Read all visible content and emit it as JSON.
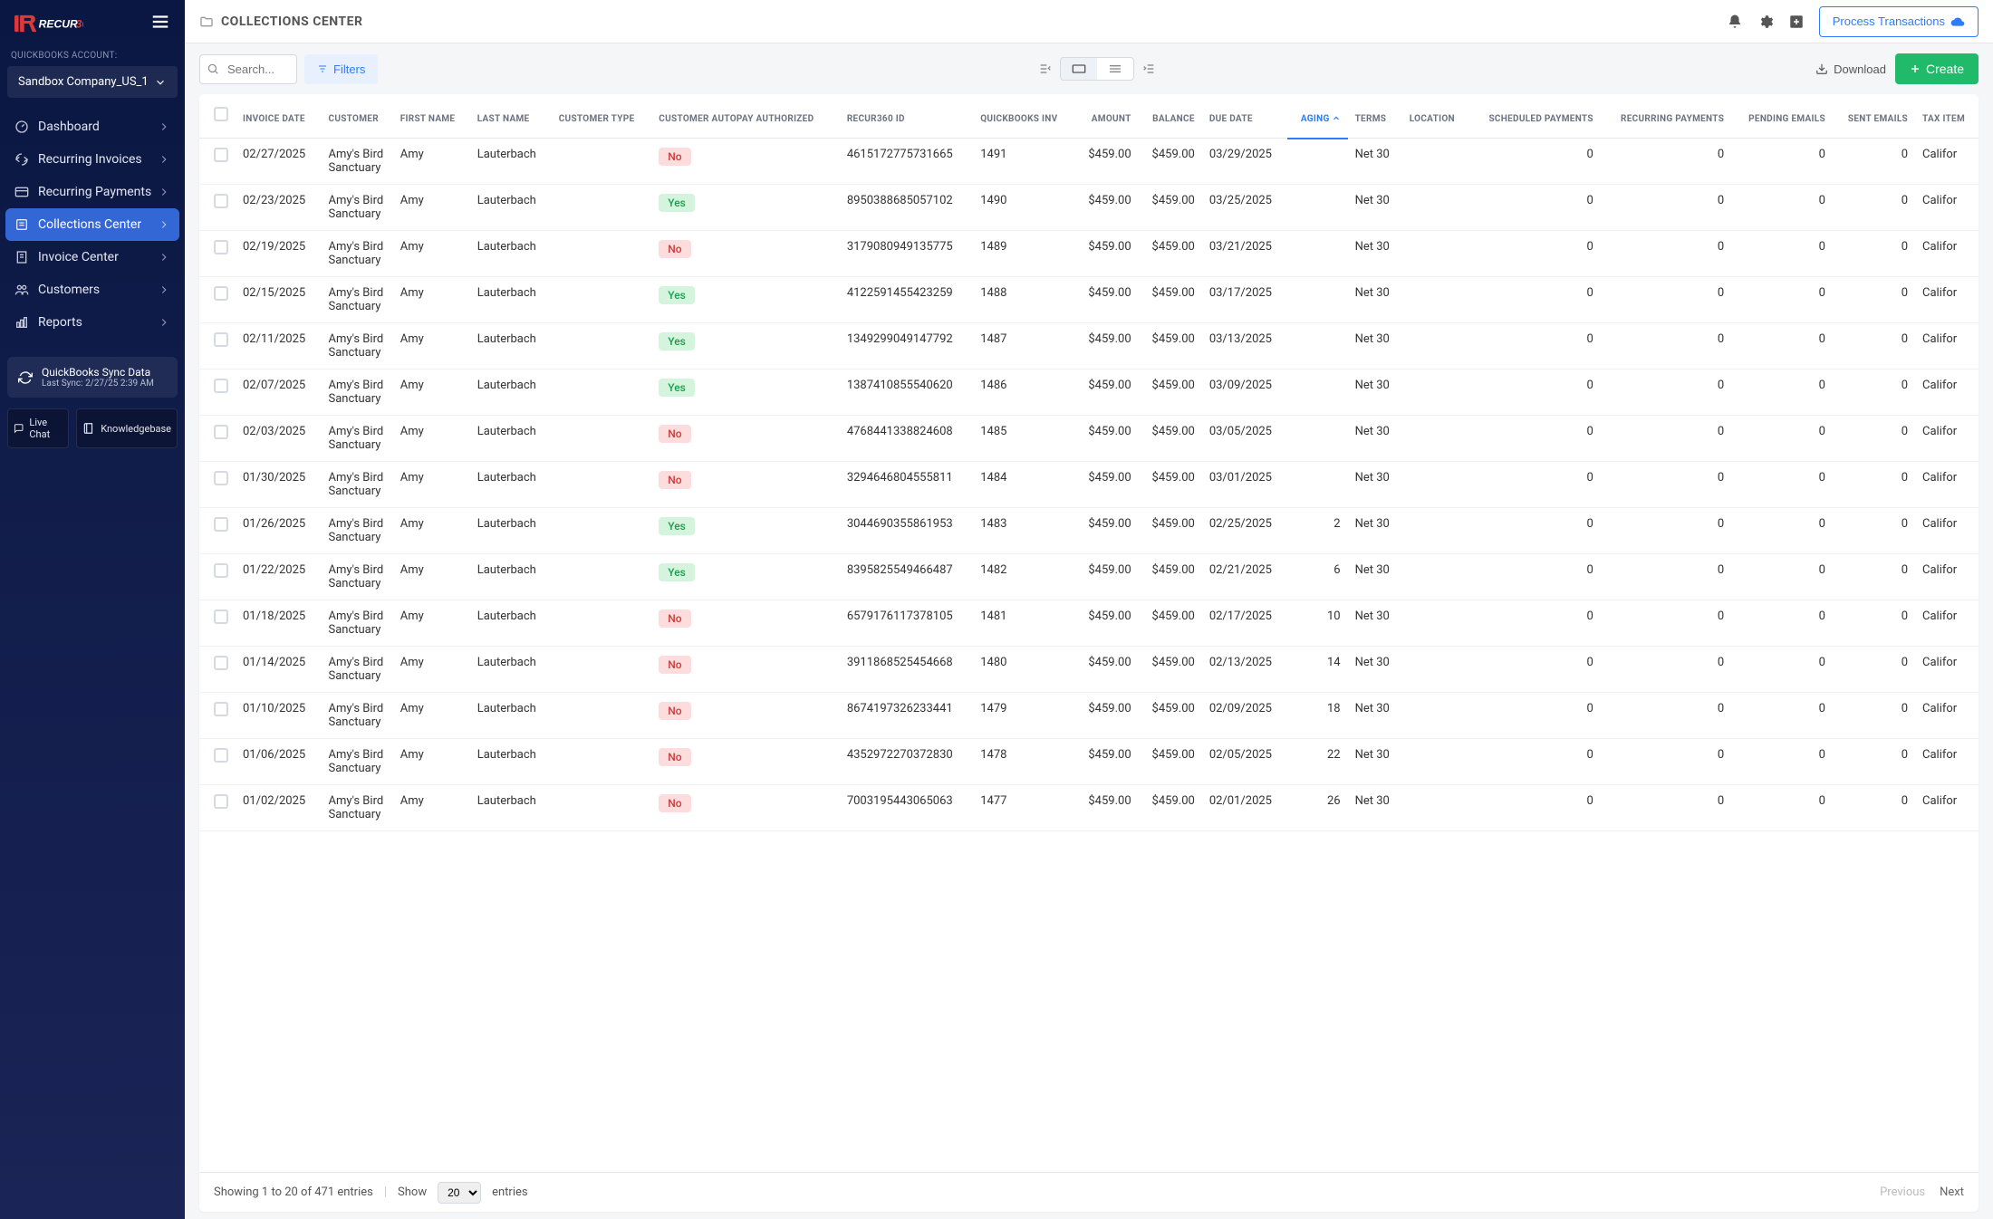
{
  "brand": {
    "name": "RECUR",
    "suffix": "360"
  },
  "qb_label": "QUICKBOOKS ACCOUNT:",
  "account": "Sandbox Company_US_1",
  "nav": [
    {
      "label": "Dashboard",
      "icon": "dashboard"
    },
    {
      "label": "Recurring Invoices",
      "icon": "recur"
    },
    {
      "label": "Recurring Payments",
      "icon": "card"
    },
    {
      "label": "Collections Center",
      "icon": "collections",
      "active": true
    },
    {
      "label": "Invoice Center",
      "icon": "invoice"
    },
    {
      "label": "Customers",
      "icon": "people"
    },
    {
      "label": "Reports",
      "icon": "bar"
    }
  ],
  "sync": {
    "title": "QuickBooks Sync Data",
    "sub": "Last Sync: 2/27/25 2:39 AM"
  },
  "help": {
    "chat": "Live Chat",
    "kb": "Knowledgebase"
  },
  "page_title": "COLLECTIONS CENTER",
  "process_btn": "Process Transactions",
  "search_placeholder": "Search...",
  "filters_btn": "Filters",
  "download_btn": "Download",
  "create_btn": "Create",
  "columns": [
    "INVOICE DATE",
    "CUSTOMER",
    "FIRST NAME",
    "LAST NAME",
    "CUSTOMER TYPE",
    "CUSTOMER AUTOPAY AUTHORIZED",
    "RECUR360 ID",
    "QUICKBOOKS INV",
    "AMOUNT",
    "BALANCE",
    "DUE DATE",
    "AGING",
    "TERMS",
    "LOCATION",
    "SCHEDULED PAYMENTS",
    "RECURRING PAYMENTS",
    "PENDING EMAILS",
    "SENT EMAILS",
    "TAX ITEM"
  ],
  "sorted_col": "AGING",
  "rows": [
    {
      "date": "02/27/2025",
      "cust": "Amy's Bird Sanctuary",
      "fn": "Amy",
      "ln": "Lauterbach",
      "ctype": "",
      "auto": "No",
      "rid": "4615172775731665",
      "qinv": "1491",
      "amt": "$459.00",
      "bal": "$459.00",
      "due": "03/29/2025",
      "aging": "",
      "terms": "Net 30",
      "loc": "",
      "sp": "0",
      "rp": "0",
      "pe": "0",
      "se": "0",
      "tax": "Califor"
    },
    {
      "date": "02/23/2025",
      "cust": "Amy's Bird Sanctuary",
      "fn": "Amy",
      "ln": "Lauterbach",
      "ctype": "",
      "auto": "Yes",
      "rid": "8950388685057102",
      "qinv": "1490",
      "amt": "$459.00",
      "bal": "$459.00",
      "due": "03/25/2025",
      "aging": "",
      "terms": "Net 30",
      "loc": "",
      "sp": "0",
      "rp": "0",
      "pe": "0",
      "se": "0",
      "tax": "Califor"
    },
    {
      "date": "02/19/2025",
      "cust": "Amy's Bird Sanctuary",
      "fn": "Amy",
      "ln": "Lauterbach",
      "ctype": "",
      "auto": "No",
      "rid": "3179080949135775",
      "qinv": "1489",
      "amt": "$459.00",
      "bal": "$459.00",
      "due": "03/21/2025",
      "aging": "",
      "terms": "Net 30",
      "loc": "",
      "sp": "0",
      "rp": "0",
      "pe": "0",
      "se": "0",
      "tax": "Califor"
    },
    {
      "date": "02/15/2025",
      "cust": "Amy's Bird Sanctuary",
      "fn": "Amy",
      "ln": "Lauterbach",
      "ctype": "",
      "auto": "Yes",
      "rid": "4122591455423259",
      "qinv": "1488",
      "amt": "$459.00",
      "bal": "$459.00",
      "due": "03/17/2025",
      "aging": "",
      "terms": "Net 30",
      "loc": "",
      "sp": "0",
      "rp": "0",
      "pe": "0",
      "se": "0",
      "tax": "Califor"
    },
    {
      "date": "02/11/2025",
      "cust": "Amy's Bird Sanctuary",
      "fn": "Amy",
      "ln": "Lauterbach",
      "ctype": "",
      "auto": "Yes",
      "rid": "1349299049147792",
      "qinv": "1487",
      "amt": "$459.00",
      "bal": "$459.00",
      "due": "03/13/2025",
      "aging": "",
      "terms": "Net 30",
      "loc": "",
      "sp": "0",
      "rp": "0",
      "pe": "0",
      "se": "0",
      "tax": "Califor"
    },
    {
      "date": "02/07/2025",
      "cust": "Amy's Bird Sanctuary",
      "fn": "Amy",
      "ln": "Lauterbach",
      "ctype": "",
      "auto": "Yes",
      "rid": "1387410855540620",
      "qinv": "1486",
      "amt": "$459.00",
      "bal": "$459.00",
      "due": "03/09/2025",
      "aging": "",
      "terms": "Net 30",
      "loc": "",
      "sp": "0",
      "rp": "0",
      "pe": "0",
      "se": "0",
      "tax": "Califor"
    },
    {
      "date": "02/03/2025",
      "cust": "Amy's Bird Sanctuary",
      "fn": "Amy",
      "ln": "Lauterbach",
      "ctype": "",
      "auto": "No",
      "rid": "4768441338824608",
      "qinv": "1485",
      "amt": "$459.00",
      "bal": "$459.00",
      "due": "03/05/2025",
      "aging": "",
      "terms": "Net 30",
      "loc": "",
      "sp": "0",
      "rp": "0",
      "pe": "0",
      "se": "0",
      "tax": "Califor"
    },
    {
      "date": "01/30/2025",
      "cust": "Amy's Bird Sanctuary",
      "fn": "Amy",
      "ln": "Lauterbach",
      "ctype": "",
      "auto": "No",
      "rid": "3294646804555811",
      "qinv": "1484",
      "amt": "$459.00",
      "bal": "$459.00",
      "due": "03/01/2025",
      "aging": "",
      "terms": "Net 30",
      "loc": "",
      "sp": "0",
      "rp": "0",
      "pe": "0",
      "se": "0",
      "tax": "Califor"
    },
    {
      "date": "01/26/2025",
      "cust": "Amy's Bird Sanctuary",
      "fn": "Amy",
      "ln": "Lauterbach",
      "ctype": "",
      "auto": "Yes",
      "rid": "3044690355861953",
      "qinv": "1483",
      "amt": "$459.00",
      "bal": "$459.00",
      "due": "02/25/2025",
      "aging": "2",
      "terms": "Net 30",
      "loc": "",
      "sp": "0",
      "rp": "0",
      "pe": "0",
      "se": "0",
      "tax": "Califor"
    },
    {
      "date": "01/22/2025",
      "cust": "Amy's Bird Sanctuary",
      "fn": "Amy",
      "ln": "Lauterbach",
      "ctype": "",
      "auto": "Yes",
      "rid": "8395825549466487",
      "qinv": "1482",
      "amt": "$459.00",
      "bal": "$459.00",
      "due": "02/21/2025",
      "aging": "6",
      "terms": "Net 30",
      "loc": "",
      "sp": "0",
      "rp": "0",
      "pe": "0",
      "se": "0",
      "tax": "Califor"
    },
    {
      "date": "01/18/2025",
      "cust": "Amy's Bird Sanctuary",
      "fn": "Amy",
      "ln": "Lauterbach",
      "ctype": "",
      "auto": "No",
      "rid": "6579176117378105",
      "qinv": "1481",
      "amt": "$459.00",
      "bal": "$459.00",
      "due": "02/17/2025",
      "aging": "10",
      "terms": "Net 30",
      "loc": "",
      "sp": "0",
      "rp": "0",
      "pe": "0",
      "se": "0",
      "tax": "Califor"
    },
    {
      "date": "01/14/2025",
      "cust": "Amy's Bird Sanctuary",
      "fn": "Amy",
      "ln": "Lauterbach",
      "ctype": "",
      "auto": "No",
      "rid": "3911868525454668",
      "qinv": "1480",
      "amt": "$459.00",
      "bal": "$459.00",
      "due": "02/13/2025",
      "aging": "14",
      "terms": "Net 30",
      "loc": "",
      "sp": "0",
      "rp": "0",
      "pe": "0",
      "se": "0",
      "tax": "Califor"
    },
    {
      "date": "01/10/2025",
      "cust": "Amy's Bird Sanctuary",
      "fn": "Amy",
      "ln": "Lauterbach",
      "ctype": "",
      "auto": "No",
      "rid": "8674197326233441",
      "qinv": "1479",
      "amt": "$459.00",
      "bal": "$459.00",
      "due": "02/09/2025",
      "aging": "18",
      "terms": "Net 30",
      "loc": "",
      "sp": "0",
      "rp": "0",
      "pe": "0",
      "se": "0",
      "tax": "Califor"
    },
    {
      "date": "01/06/2025",
      "cust": "Amy's Bird Sanctuary",
      "fn": "Amy",
      "ln": "Lauterbach",
      "ctype": "",
      "auto": "No",
      "rid": "4352972270372830",
      "qinv": "1478",
      "amt": "$459.00",
      "bal": "$459.00",
      "due": "02/05/2025",
      "aging": "22",
      "terms": "Net 30",
      "loc": "",
      "sp": "0",
      "rp": "0",
      "pe": "0",
      "se": "0",
      "tax": "Califor"
    },
    {
      "date": "01/02/2025",
      "cust": "Amy's Bird Sanctuary",
      "fn": "Amy",
      "ln": "Lauterbach",
      "ctype": "",
      "auto": "No",
      "rid": "7003195443065063",
      "qinv": "1477",
      "amt": "$459.00",
      "bal": "$459.00",
      "due": "02/01/2025",
      "aging": "26",
      "terms": "Net 30",
      "loc": "",
      "sp": "0",
      "rp": "0",
      "pe": "0",
      "se": "0",
      "tax": "Califor"
    }
  ],
  "footer": {
    "showing": "Showing 1 to 20 of 471 entries",
    "show": "Show",
    "page_size": "20",
    "entries": "entries",
    "prev": "Previous",
    "next": "Next"
  }
}
